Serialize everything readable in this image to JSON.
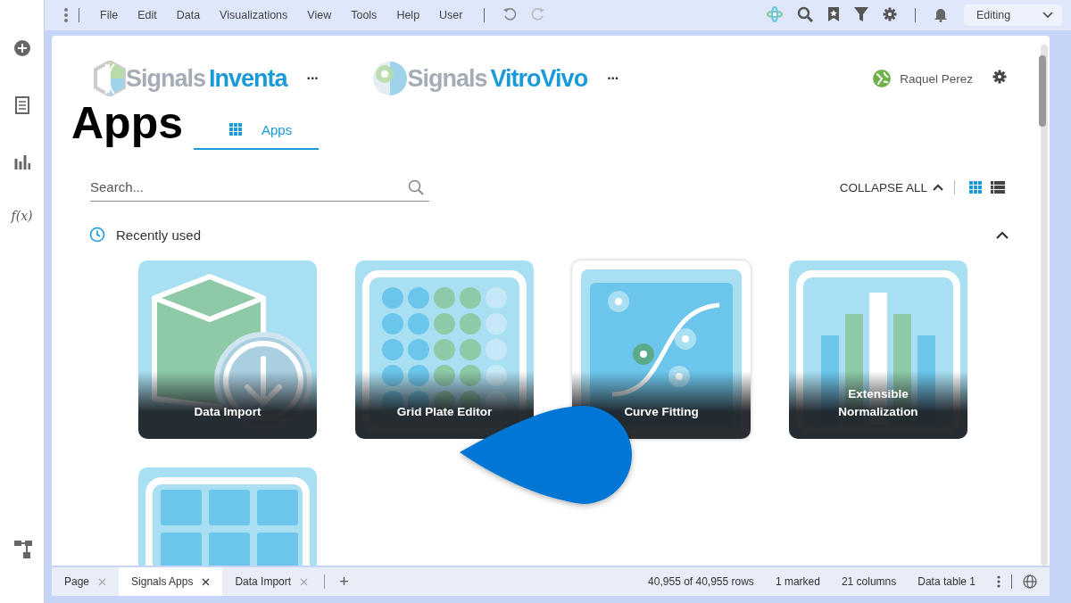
{
  "sidebar": {
    "formula_label": "f(x)"
  },
  "menubar": {
    "items": [
      "File",
      "Edit",
      "Data",
      "Visualizations",
      "View",
      "Tools",
      "Help",
      "User"
    ],
    "mode": "Editing"
  },
  "header": {
    "logos": [
      {
        "brand": "Signals",
        "product": "Inventa",
        "kind": "helix"
      },
      {
        "brand": "Signals",
        "product": "VitroVivo",
        "kind": "eye"
      }
    ],
    "more": "···",
    "user": "Raquel Perez"
  },
  "page_title": "Apps",
  "tabs": [
    {
      "label": "Apps",
      "selected": true
    }
  ],
  "search": {
    "placeholder": "Search..."
  },
  "collapse_all": "COLLAPSE ALL",
  "views": [
    {
      "kind": "grid",
      "selected": true
    },
    {
      "kind": "list",
      "selected": false
    }
  ],
  "section": {
    "title": "Recently used",
    "expanded": true
  },
  "tiles": [
    {
      "label": "Data Import",
      "kind": "box",
      "selected": false
    },
    {
      "label": "Grid Plate Editor",
      "kind": "plate",
      "selected": false
    },
    {
      "label": "Curve Fitting",
      "kind": "curve",
      "selected": true
    },
    {
      "label": "Extensible\nNormalization",
      "kind": "bars",
      "selected": false
    },
    {
      "kind": "table",
      "selected": false
    }
  ],
  "page_tabs": [
    {
      "label": "Page",
      "selected": false
    },
    {
      "label": "Signals Apps",
      "selected": true
    },
    {
      "label": "Data Import",
      "selected": false
    }
  ],
  "add_tab": "+",
  "status": [
    "40,955 of 40,955 rows",
    "1 marked",
    "21 columns",
    "Data table 1"
  ]
}
